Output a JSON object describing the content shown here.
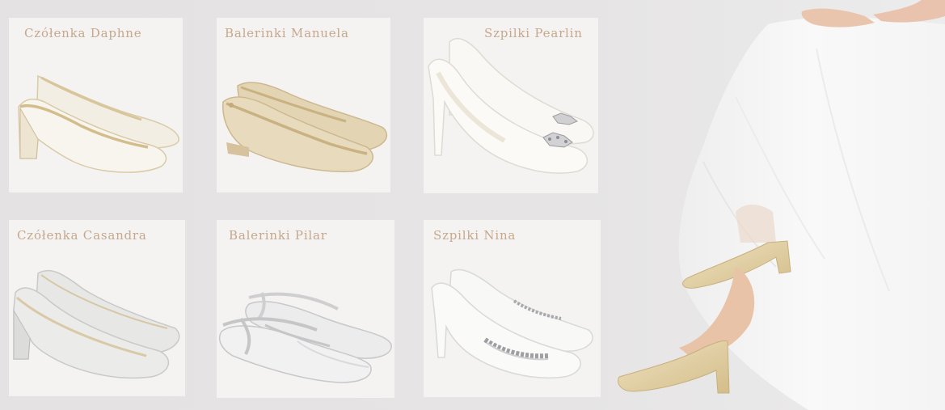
{
  "products": [
    {
      "name": "Czółenka Daphne",
      "shoe_icon": "block-heel-pump-icon",
      "color": "#f6f2ea"
    },
    {
      "name": "Balerinki Manuela",
      "shoe_icon": "ballet-flat-icon",
      "color": "#e8dcc2"
    },
    {
      "name": "Szpilki Pearlin",
      "shoe_icon": "stiletto-pump-brooch-icon",
      "color": "#f7f6f2"
    },
    {
      "name": "Czółenka Casandra",
      "shoe_icon": "block-heel-pump-icon",
      "color": "#e9e9e8"
    },
    {
      "name": "Balerinki Pilar",
      "shoe_icon": "strappy-flat-icon",
      "color": "#eeeeef"
    },
    {
      "name": "Szpilki Nina",
      "shoe_icon": "kitten-heel-pump-crystal-icon",
      "color": "#f8f8f7"
    }
  ],
  "hero": {
    "image": "bride-in-gold-heels-image",
    "dress_color": "#f7f6f6",
    "shoe_color": "#e3d3ac"
  },
  "label_color": "#c5a88d"
}
